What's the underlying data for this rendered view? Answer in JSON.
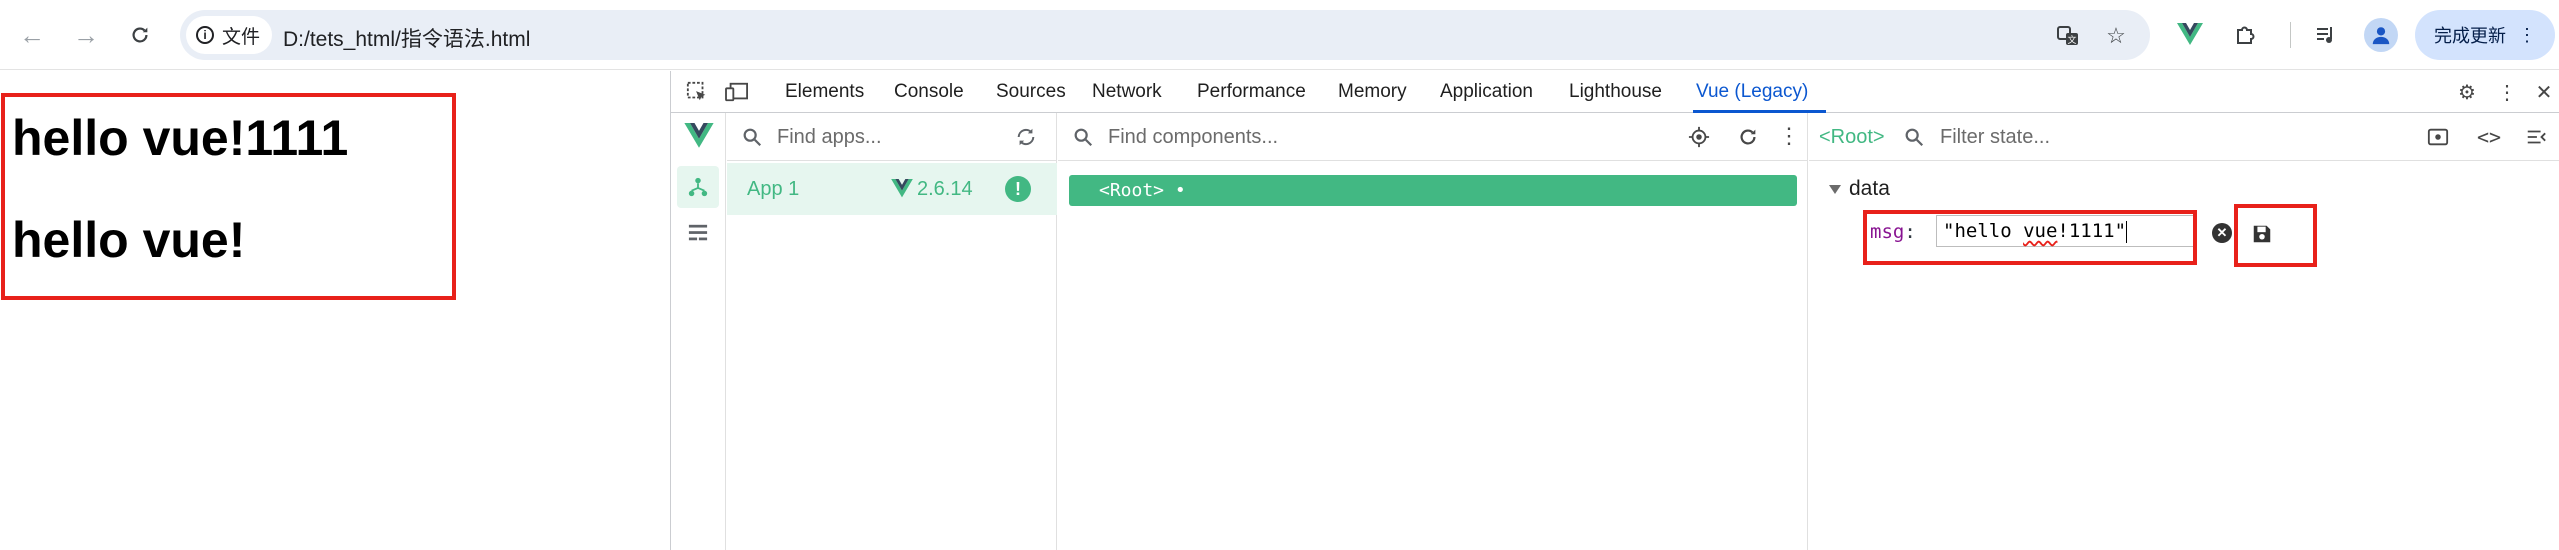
{
  "browser": {
    "site_info_label": "文件",
    "url": "D:/tets_html/指令语法.html",
    "update_button_label": "完成更新",
    "update_menu_glyph": "⋮"
  },
  "page": {
    "heading_1": "hello vue!1111",
    "heading_2": "hello vue!"
  },
  "devtools": {
    "tabs": [
      "Elements",
      "Console",
      "Sources",
      "Network",
      "Performance",
      "Memory",
      "Application",
      "Lighthouse",
      "Vue (Legacy)"
    ],
    "active_tab": "Vue (Legacy)"
  },
  "vue": {
    "apps_search_placeholder": "Find apps...",
    "app": {
      "name": "App 1",
      "version": "2.6.14",
      "warning": "!"
    },
    "components_search_placeholder": "Find components...",
    "root_component": "<Root> •",
    "state": {
      "breadcrumb": "<Root>",
      "filter_placeholder": "Filter state...",
      "section": "data",
      "key": "msg",
      "colon": ":",
      "value_prefix": "\"hello ",
      "value_misspelled": "vue",
      "value_suffix": "!1111\""
    }
  },
  "colors": {
    "vue_green": "#42b883",
    "highlight_red": "#e8211a",
    "chrome_blue": "#0b57d0"
  }
}
